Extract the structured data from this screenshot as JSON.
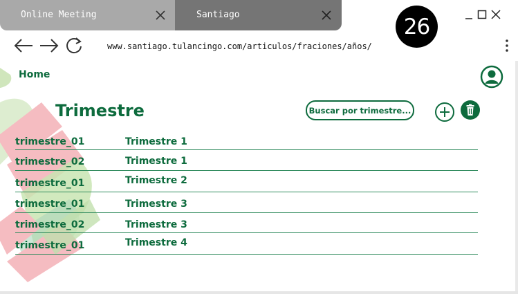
{
  "browser": {
    "tabs": [
      {
        "title": "Online Meeting",
        "active": false
      },
      {
        "title": "Santiago",
        "active": true
      }
    ],
    "url": "www.santiago.tulancingo.com/articulos/fraciones/años/",
    "badge_number": "26"
  },
  "page": {
    "home_label": "Home",
    "title": "Trimestre",
    "search_button_label": "Buscar por trimestre...",
    "rows": [
      {
        "id": "trimestre_01",
        "name": "Trimestre 1"
      },
      {
        "id": "trimestre_02",
        "name": "Trimestre 1"
      },
      {
        "id": "trimestre_01",
        "name": "Trimestre 2"
      },
      {
        "id": "trimestre_01",
        "name": "Trimestre 3"
      },
      {
        "id": "trimestre_02",
        "name": "Trimestre 3"
      },
      {
        "id": "trimestre_01",
        "name": "Trimestre 4"
      }
    ]
  },
  "colors": {
    "brand_green": "#0d6b3d",
    "tab_inactive": "#a9a9a9",
    "tab_active": "#757575",
    "deco_red": "#f2a0a8",
    "deco_green": "#b9dca0"
  },
  "icons": {
    "tab_close": "close-icon",
    "back": "arrow-left-icon",
    "forward": "arrow-right-icon",
    "reload": "reload-icon",
    "menu": "kebab-menu-icon",
    "avatar": "user-icon",
    "add": "plus-circle-icon",
    "delete": "trash-icon"
  }
}
